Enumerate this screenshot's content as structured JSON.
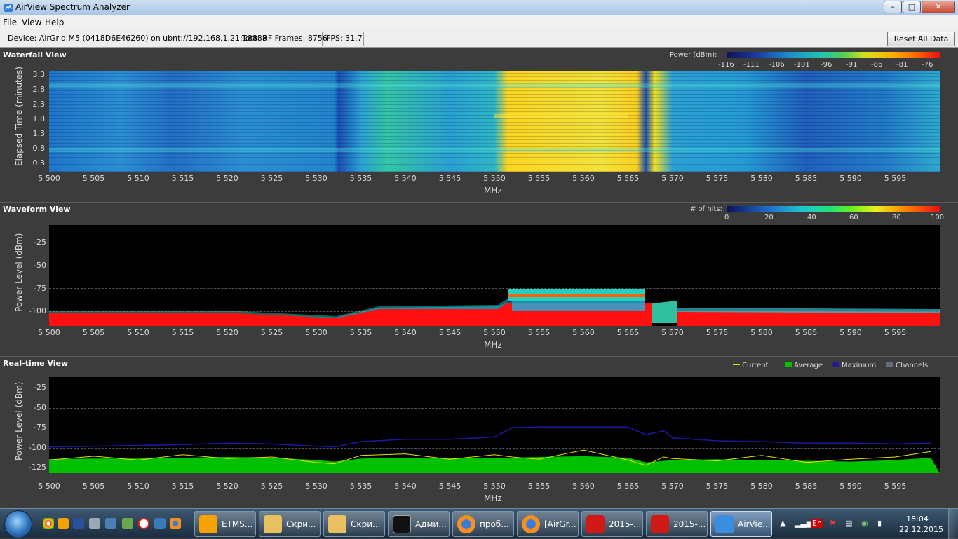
{
  "window": {
    "title": "AirView Spectrum Analyzer",
    "min_label": "–",
    "max_label": "□",
    "close_label": "✕"
  },
  "menu": {
    "file": "File",
    "view": "View",
    "help": "Help"
  },
  "status": {
    "device": "Device: AirGrid M5 (0418D6E46260) on ubnt://192.168.1.21:18888",
    "frames": "Total RF Frames: 8756",
    "fps": "FPS: 31.7",
    "reset_label": "Reset All Data"
  },
  "waterfall": {
    "title": "Waterfall View",
    "legend_title": "Power (dBm):",
    "legend_ticks": [
      "-116",
      "-111",
      "-106",
      "-101",
      "-96",
      "-91",
      "-86",
      "-81",
      "-76"
    ],
    "ylabel": "Elapsed Time (minutes)",
    "yticks": [
      "3.3",
      "2.8",
      "2.3",
      "1.8",
      "1.3",
      "0.8",
      "0.3"
    ],
    "xlabel": "MHz"
  },
  "waveform": {
    "title": "Waveform View",
    "legend_title": "# of hits:",
    "legend_ticks": [
      "0",
      "20",
      "40",
      "60",
      "80",
      "100"
    ],
    "ylabel": "Power Level (dBm)",
    "yticks": [
      "-25",
      "-50",
      "-75",
      "-100"
    ],
    "xlabel": "MHz"
  },
  "realtime": {
    "title": "Real-time View",
    "legend": [
      "Current",
      "Average",
      "Maximum",
      "Channels"
    ],
    "ylabel": "Power Level (dBm)",
    "yticks": [
      "-25",
      "-50",
      "-75",
      "-100",
      "-125"
    ],
    "xlabel": "MHz"
  },
  "xticks": [
    "5 500",
    "5 505",
    "5 510",
    "5 515",
    "5 520",
    "5 525",
    "5 530",
    "5 535",
    "5 540",
    "5 545",
    "5 550",
    "5 555",
    "5 560",
    "5 565",
    "5 570",
    "5 575",
    "5 580",
    "5 585",
    "5 590",
    "5 595"
  ],
  "colors": {
    "current": "#e8e000",
    "average": "#00c000",
    "maximum": "#1a1aa0",
    "channels": "#607080",
    "waveform_floor": "#ff1010"
  },
  "chart_data": [
    {
      "type": "line",
      "title": "Real-time View",
      "xlabel": "MHz",
      "ylabel": "Power Level (dBm)",
      "xlim": [
        5500,
        5600
      ],
      "ylim": [
        -135,
        -10
      ],
      "grid": true,
      "legend_position": "top-right",
      "x": [
        5500,
        5505,
        5510,
        5515,
        5520,
        5525,
        5530,
        5532,
        5535,
        5540,
        5545,
        5550,
        5552,
        5555,
        5560,
        5565,
        5567,
        5569,
        5570,
        5575,
        5580,
        5585,
        5590,
        5595,
        5599
      ],
      "series": [
        {
          "name": "Maximum",
          "values": [
            -101,
            -100,
            -99,
            -98,
            -96,
            -97,
            -100,
            -101,
            -94,
            -91,
            -91,
            -88,
            -76,
            -75,
            -75,
            -75,
            -85,
            -80,
            -89,
            -93,
            -94,
            -96,
            -96,
            -97,
            -96
          ]
        },
        {
          "name": "Average",
          "values": [
            -117,
            -116,
            -116,
            -115,
            -114,
            -115,
            -118,
            -120,
            -116,
            -115,
            -115,
            -115,
            -115,
            -114,
            -113,
            -115,
            -121,
            -119,
            -118,
            -117,
            -118,
            -119,
            -120,
            -118,
            -115
          ]
        },
        {
          "name": "Current",
          "values": [
            -118,
            -113,
            -118,
            -111,
            -116,
            -114,
            -121,
            -123,
            -112,
            -110,
            -117,
            -111,
            -114,
            -117,
            -105,
            -118,
            -125,
            -114,
            -116,
            -119,
            -112,
            -121,
            -117,
            -114,
            -107
          ]
        }
      ]
    }
  ]
}
